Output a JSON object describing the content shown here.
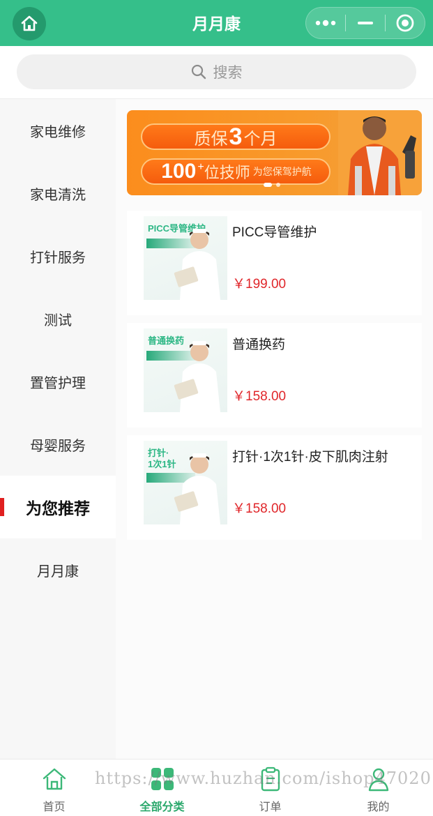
{
  "header": {
    "title": "月月康",
    "icons": [
      "home-icon",
      "more-dots-icon",
      "minimize-icon",
      "close-target-icon"
    ],
    "color": "#35bf8a"
  },
  "search": {
    "placeholder": "搜索",
    "icon": "search-icon"
  },
  "sidebar": {
    "items": [
      {
        "label": "家电维修"
      },
      {
        "label": "家电清洗"
      },
      {
        "label": "打针服务"
      },
      {
        "label": "测试"
      },
      {
        "label": "置管护理"
      },
      {
        "label": "母婴服务"
      },
      {
        "label": "为您推荐",
        "active": true
      },
      {
        "label": "月月康"
      }
    ],
    "active_indicator_color": "#e02020"
  },
  "banner": {
    "line1_prefix": "质保",
    "line1_number": "3",
    "line1_suffix": "个月",
    "line2_number": "100",
    "line2_plus": "+",
    "line2_text": "位技师",
    "line2_small": "为您保驾护航",
    "slides": 2,
    "active_slide": 1
  },
  "products": [
    {
      "name": "PICC导管维护",
      "price": "￥199.00",
      "thumb_title": "PICC导管维护"
    },
    {
      "name": "普通换药",
      "price": "￥158.00",
      "thumb_title": "普通换药"
    },
    {
      "name": "打针·1次1针·皮下肌肉注射",
      "price": "￥158.00",
      "thumb_title_line1": "打针·",
      "thumb_title_line2": "1次1针"
    }
  ],
  "tabbar": {
    "tabs": [
      {
        "label": "首页",
        "icon": "home-icon"
      },
      {
        "label": "全部分类",
        "icon": "category-grid-icon",
        "active": true
      },
      {
        "label": "订单",
        "icon": "order-clipboard-icon"
      },
      {
        "label": "我的",
        "icon": "user-icon"
      }
    ],
    "active_color": "#2aa86b"
  },
  "watermark": "https://www.huzhan.com/ishop47020",
  "colors": {
    "price": "#e0262a",
    "brand": "#35bf8a"
  }
}
